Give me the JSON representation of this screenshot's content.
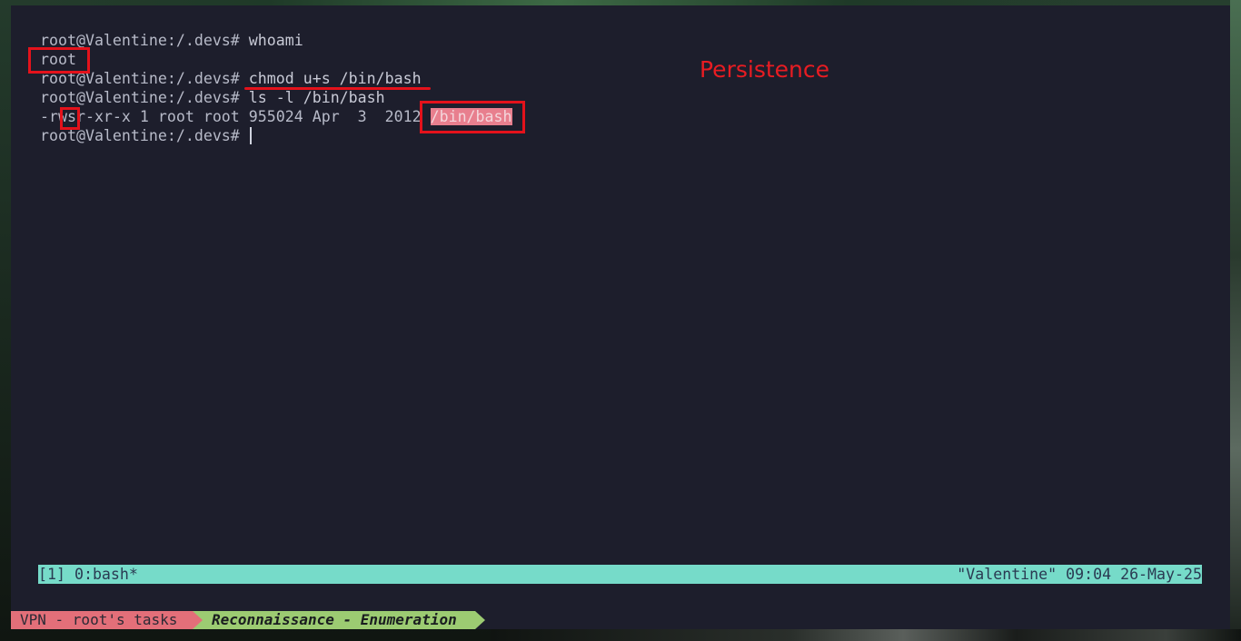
{
  "terminal": {
    "lines": {
      "l1_prompt": "root@Valentine:/.devs# ",
      "l1_cmd": "whoami",
      "l2_out": "root",
      "l3_prompt": "root@Valentine:/.devs# ",
      "l3_cmd": "chmod u+s /bin/bash",
      "l4_prompt": "root@Valentine:/.devs# ",
      "l4_cmd": "ls -l /bin/bash",
      "l5_perms": "-rwsr-xr-x 1 root root 955024 Apr  3  2012 ",
      "l5_path": "/bin/bash",
      "l6_prompt": "root@Valentine:/.devs# "
    },
    "annotation_label": "Persistence"
  },
  "tmux": {
    "left": "[1] 0:bash*",
    "right": "\"Valentine\" 09:04 26-May-25"
  },
  "powerline": {
    "vpn": "VPN - root's tasks",
    "task": "Reconnaissance - Enumeration"
  },
  "colors": {
    "terminal_bg": "#1d1e2c",
    "annotation_red": "#e4121b",
    "tmux_bar": "#76dbc9",
    "vpn_segment": "#e36f79",
    "task_segment": "#9ccb72"
  }
}
